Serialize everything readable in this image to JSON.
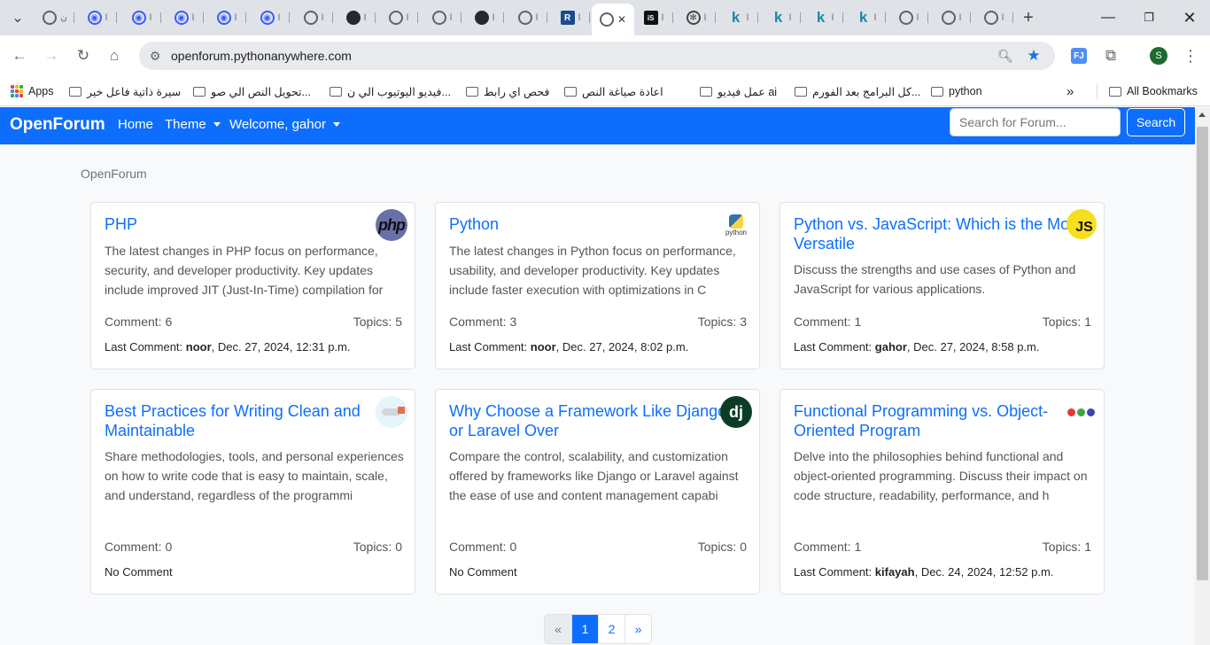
{
  "browser": {
    "tabs": [
      {
        "icon": "globe-icon",
        "color": "#5f6368",
        "label": "ن"
      },
      {
        "icon": "copilot-icon",
        "color": "#3b5bfd",
        "label": "ا"
      },
      {
        "icon": "copilot-icon",
        "color": "#3b5bfd",
        "label": "ا"
      },
      {
        "icon": "copilot-icon",
        "color": "#3b5bfd",
        "label": "ا"
      },
      {
        "icon": "copilot-icon",
        "color": "#3b5bfd",
        "label": "ا"
      },
      {
        "icon": "copilot-icon",
        "color": "#3b5bfd",
        "label": "ا"
      },
      {
        "icon": "globe-icon",
        "color": "#5f6368",
        "label": "ا"
      },
      {
        "icon": "github-icon",
        "color": "#24292f",
        "label": "ا"
      },
      {
        "icon": "globe-icon",
        "color": "#5f6368",
        "label": "ا"
      },
      {
        "icon": "globe-icon",
        "color": "#5f6368",
        "label": "ا"
      },
      {
        "icon": "github-icon",
        "color": "#24292f",
        "label": "ا"
      },
      {
        "icon": "globe-icon",
        "color": "#5f6368",
        "label": "ا"
      },
      {
        "icon": "r-icon",
        "color": "#1a4d8c",
        "label": "ا"
      },
      {
        "icon": "openforum-icon",
        "color": "#5f6368",
        "label": "ا"
      },
      {
        "icon": "is-icon",
        "color": "#111111",
        "label": "ا"
      },
      {
        "icon": "chatgpt-icon",
        "color": "#444444",
        "label": "ا"
      },
      {
        "icon": "k-icon",
        "color": "#1e88a8",
        "label": "ا"
      },
      {
        "icon": "k-icon",
        "color": "#1e88a8",
        "label": "ا"
      },
      {
        "icon": "k-icon",
        "color": "#1e88a8",
        "label": "ا"
      },
      {
        "icon": "k-icon",
        "color": "#1e88a8",
        "label": "ا"
      },
      {
        "icon": "globe-icon",
        "color": "#5f6368",
        "label": "ا"
      },
      {
        "icon": "globe-icon",
        "color": "#5f6368",
        "label": "ا"
      },
      {
        "icon": "globe-icon",
        "color": "#5f6368",
        "label": "ا"
      }
    ],
    "url": "openforum.pythonanywhere.com",
    "profile_initial": "S",
    "bookmarks": [
      {
        "label": "Apps",
        "type": "apps"
      },
      {
        "label": "سيرة ذاتية فاعل خير",
        "type": "folder"
      },
      {
        "label": "تحويل النص الي صو...",
        "type": "folder"
      },
      {
        "label": "فيديو اليوتيوب الي ن...",
        "type": "folder"
      },
      {
        "label": "فحص اي رابط",
        "type": "folder"
      },
      {
        "label": "اعادة صياغة النص",
        "type": "folder"
      },
      {
        "label": "عمل فيديو ai",
        "type": "folder"
      },
      {
        "label": "كل البرامج بعد الفورم...",
        "type": "folder"
      },
      {
        "label": "python",
        "type": "folder"
      }
    ],
    "all_bookmarks": "All Bookmarks"
  },
  "site": {
    "brand": "OpenForum",
    "nav": {
      "home": "Home",
      "theme": "Theme",
      "welcome": "Welcome, gahor"
    },
    "search": {
      "placeholder": "Search for Forum...",
      "button": "Search"
    },
    "page_title": "OpenForum"
  },
  "cards": [
    {
      "title": "PHP",
      "description": "The latest changes in PHP focus on performance, security, and developer productivity. Key updates include improved JIT (Just-In-Time) compilation for",
      "comments": "Comment: 6",
      "topics": "Topics: 5",
      "last_prefix": "Last Comment:",
      "last_user": "noor",
      "last_date": ", Dec. 27, 2024, 12:31 p.m.",
      "avatar": "php-logo-icon",
      "avatar_text": "php"
    },
    {
      "title": "Python",
      "description": "The latest changes in Python focus on performance, usability, and developer productivity. Key updates include faster execution with optimizations in C",
      "comments": "Comment: 3",
      "topics": "Topics: 3",
      "last_prefix": "Last Comment:",
      "last_user": "noor",
      "last_date": ", Dec. 27, 2024, 8:02 p.m.",
      "avatar": "python-logo-icon",
      "avatar_text": "python"
    },
    {
      "title": "Python vs. JavaScript: Which is the Most Versatile",
      "description": "Discuss the strengths and use cases of Python and JavaScript for various applications.",
      "comments": "Comment: 1",
      "topics": "Topics: 1",
      "last_prefix": "Last Comment:",
      "last_user": "gahor",
      "last_date": ", Dec. 27, 2024, 8:58 p.m.",
      "avatar": "js-logo-icon",
      "avatar_text": "JS"
    },
    {
      "title": "Best Practices for Writing Clean and Maintainable",
      "description": "Share methodologies, tools, and personal experiences on how to write code that is easy to maintain, scale, and understand, regardless of the programmi",
      "comments": "Comment: 0",
      "topics": "Topics: 0",
      "no_comment": "No Comment",
      "avatar": "clean-code-icon",
      "avatar_text": ""
    },
    {
      "title": "Why Choose a Framework Like Django or Laravel Over",
      "description": "Compare the control, scalability, and customization offered by frameworks like Django or Laravel against the ease of use and content management capabi",
      "comments": "Comment: 0",
      "topics": "Topics: 0",
      "no_comment": "No Comment",
      "avatar": "django-logo-icon",
      "avatar_text": "dj"
    },
    {
      "title": "Functional Programming vs. Object-Oriented Program",
      "description": "Delve into the philosophies behind functional and object-oriented programming. Discuss their impact on code structure, readability, performance, and h",
      "comments": "Comment: 1",
      "topics": "Topics: 1",
      "last_prefix": "Last Comment:",
      "last_user": "kifayah",
      "last_date": ", Dec. 24, 2024, 12:52 p.m.",
      "avatar": "fp-oop-icon",
      "avatar_text": ""
    }
  ],
  "pagination": {
    "prev": "«",
    "pages": [
      "1",
      "2"
    ],
    "current": "1",
    "next": "»"
  }
}
